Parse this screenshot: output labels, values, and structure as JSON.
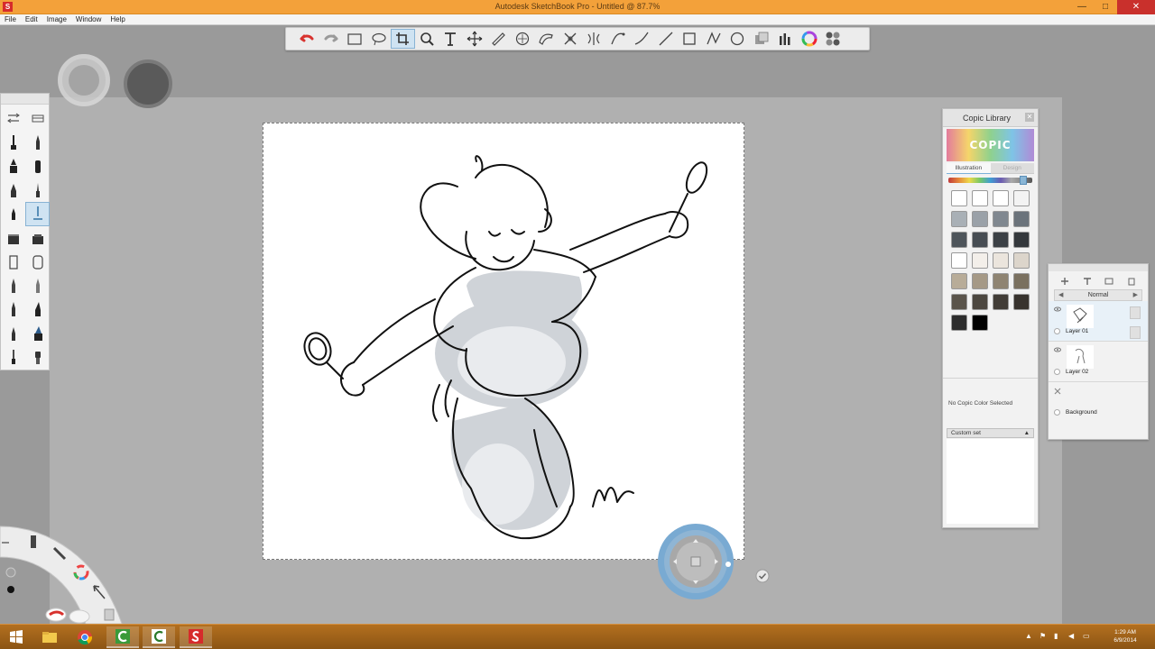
{
  "window": {
    "title": "Autodesk SketchBook Pro - Untitled @ 87.7%",
    "app_icon": "S",
    "minimize": "—",
    "maximize": "□",
    "close": "✕"
  },
  "menu": [
    "File",
    "Edit",
    "Image",
    "Window",
    "Help"
  ],
  "toolbar": {
    "icons": [
      "undo-icon",
      "redo-icon",
      "rectangle-select-icon",
      "lasso-select-icon",
      "crop-icon",
      "zoom-icon",
      "text-icon",
      "transform-icon",
      "ruler-icon",
      "ellipse-guide-icon",
      "french-curve-icon",
      "symmetry-icon",
      "symmetry-radial-icon",
      "pen-curve-icon",
      "stroke-icon",
      "line-icon",
      "rect-shape-icon",
      "polyline-icon",
      "ellipse-shape-icon",
      "layer-editor-icon",
      "brush-palette-icon",
      "color-wheel-icon",
      "copic-library-icon"
    ],
    "active": "crop-icon"
  },
  "copic": {
    "title": "Copic Library",
    "logo": "COPIC",
    "tabs": [
      "Illustration",
      "Design"
    ],
    "swatches": [
      "#ffffff",
      "#ffffff",
      "#ffffff",
      "#f3f3f3",
      "#a9b0b6",
      "#9aa1a8",
      "#808890",
      "#6b737b",
      "#4e555b",
      "#474d53",
      "#3c4146",
      "#34383c",
      "#ffffff",
      "#f3efea",
      "#ebe5dd",
      "#dcd5cb",
      "#b8ac98",
      "#a59986",
      "#8f8472",
      "#7a705f",
      "#5a544b",
      "#4c4740",
      "#423d37",
      "#38332e",
      "#2d2d2d",
      "#000000"
    ],
    "status": "No Copic Color Selected",
    "set_label": "Custom set",
    "set_caret": "▲"
  },
  "layers": {
    "blend_mode": "Normal",
    "mode_prev": "◀",
    "mode_next": "▶",
    "items": [
      {
        "name": "Layer 01"
      },
      {
        "name": "Layer 02"
      },
      {
        "name": "Background"
      }
    ]
  },
  "taskbar": {
    "clock_time": "1:29 AM",
    "clock_date": "6/9/2014",
    "apps": [
      "start-icon",
      "file-explorer-icon",
      "chrome-icon",
      "camtasia-icon",
      "camtasia-recorder-icon",
      "sketchbook-icon"
    ]
  }
}
